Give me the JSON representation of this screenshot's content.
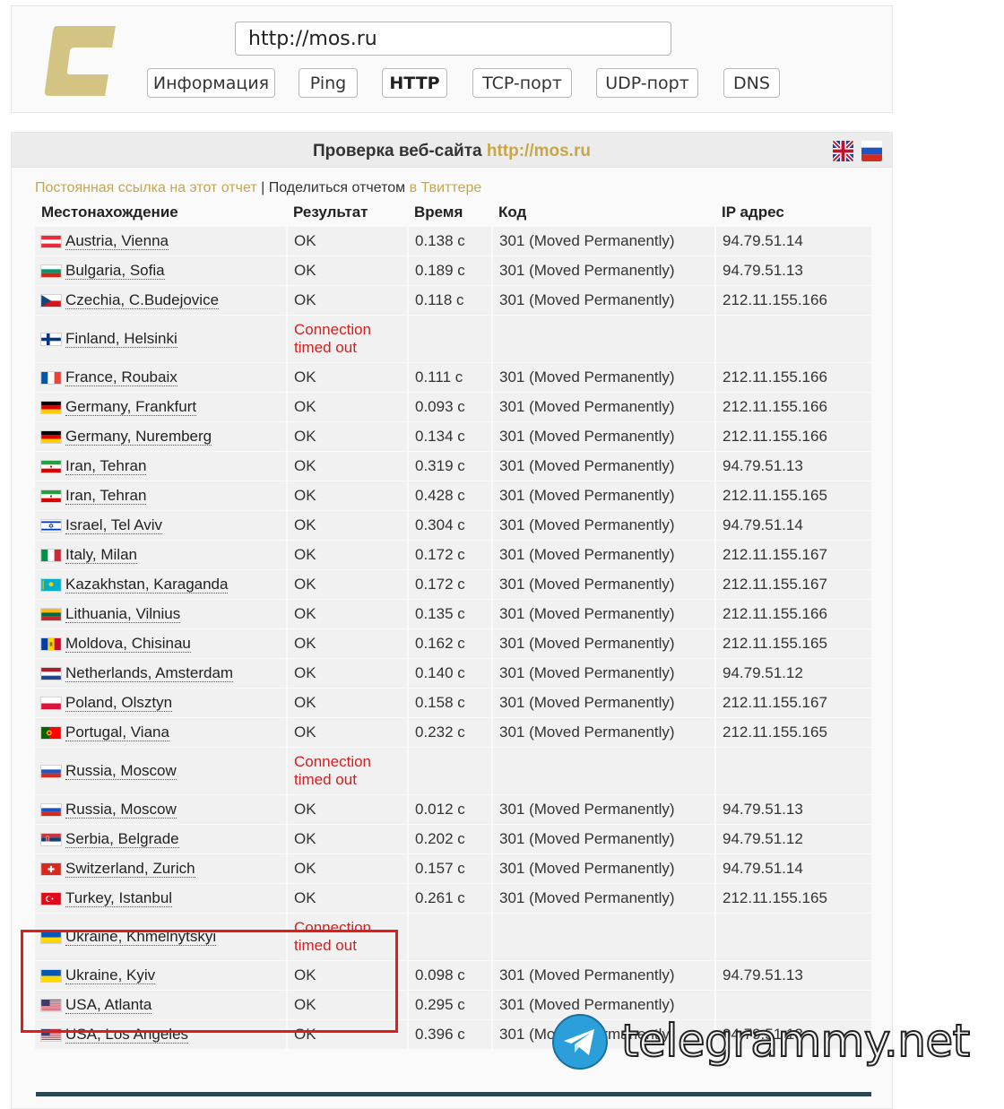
{
  "header": {
    "url_value": "http://mos.ru",
    "nav": [
      {
        "label": "Информация",
        "active": false
      },
      {
        "label": "Ping",
        "active": false
      },
      {
        "label": "HTTP",
        "active": true
      },
      {
        "label": "TCP-порт",
        "active": false
      },
      {
        "label": "UDP-порт",
        "active": false
      },
      {
        "label": "DNS",
        "active": false
      }
    ],
    "logo_color": "#d4c484"
  },
  "report": {
    "title_prefix": "Проверка веб-сайта",
    "title_link": "http://mos.ru",
    "permalink": "Постоянная ссылка на этот отчет",
    "divider": " | ",
    "share_text": "Поделиться отчетом",
    "share_link": "в Твиттере",
    "lang_flags": [
      "uk-flag-icon",
      "ru-flag-icon"
    ]
  },
  "table": {
    "headers": {
      "location": "Местонахождение",
      "result": "Результат",
      "time": "Время",
      "code": "Код",
      "ip": "IP адрес"
    },
    "rows": [
      {
        "flag": "at",
        "location": "Austria, Vienna",
        "result": "OK",
        "time": "0.138 с",
        "code": "301 (Moved Permanently)",
        "ip": "94.79.51.14"
      },
      {
        "flag": "bg",
        "location": "Bulgaria, Sofia",
        "result": "OK",
        "time": "0.189 с",
        "code": "301 (Moved Permanently)",
        "ip": "94.79.51.13"
      },
      {
        "flag": "cz",
        "location": "Czechia, C.Budejovice",
        "result": "OK",
        "time": "0.118 с",
        "code": "301 (Moved Permanently)",
        "ip": "212.11.155.166"
      },
      {
        "flag": "fi",
        "location": "Finland, Helsinki",
        "result_line1": "Connection",
        "result_line2": "timed out",
        "error": true
      },
      {
        "flag": "fr",
        "location": "France, Roubaix",
        "result": "OK",
        "time": "0.111 с",
        "code": "301 (Moved Permanently)",
        "ip": "212.11.155.166"
      },
      {
        "flag": "de",
        "location": "Germany, Frankfurt",
        "result": "OK",
        "time": "0.093 с",
        "code": "301 (Moved Permanently)",
        "ip": "212.11.155.166"
      },
      {
        "flag": "de",
        "location": "Germany, Nuremberg",
        "result": "OK",
        "time": "0.134 с",
        "code": "301 (Moved Permanently)",
        "ip": "212.11.155.166"
      },
      {
        "flag": "ir",
        "location": "Iran, Tehran",
        "result": "OK",
        "time": "0.319 с",
        "code": "301 (Moved Permanently)",
        "ip": "94.79.51.13"
      },
      {
        "flag": "ir",
        "location": "Iran, Tehran",
        "result": "OK",
        "time": "0.428 с",
        "code": "301 (Moved Permanently)",
        "ip": "212.11.155.165"
      },
      {
        "flag": "il",
        "location": "Israel, Tel Aviv",
        "result": "OK",
        "time": "0.304 с",
        "code": "301 (Moved Permanently)",
        "ip": "94.79.51.14"
      },
      {
        "flag": "it",
        "location": "Italy, Milan",
        "result": "OK",
        "time": "0.172 с",
        "code": "301 (Moved Permanently)",
        "ip": "212.11.155.167"
      },
      {
        "flag": "kz",
        "location": "Kazakhstan, Karaganda",
        "result": "OK",
        "time": "0.172 с",
        "code": "301 (Moved Permanently)",
        "ip": "212.11.155.167"
      },
      {
        "flag": "lt",
        "location": "Lithuania, Vilnius",
        "result": "OK",
        "time": "0.135 с",
        "code": "301 (Moved Permanently)",
        "ip": "212.11.155.166"
      },
      {
        "flag": "md",
        "location": "Moldova, Chisinau",
        "result": "OK",
        "time": "0.162 с",
        "code": "301 (Moved Permanently)",
        "ip": "212.11.155.165"
      },
      {
        "flag": "nl",
        "location": "Netherlands, Amsterdam",
        "result": "OK",
        "time": "0.140 с",
        "code": "301 (Moved Permanently)",
        "ip": "94.79.51.12"
      },
      {
        "flag": "pl",
        "location": "Poland, Olsztyn",
        "result": "OK",
        "time": "0.158 с",
        "code": "301 (Moved Permanently)",
        "ip": "212.11.155.167"
      },
      {
        "flag": "pt",
        "location": "Portugal, Viana",
        "result": "OK",
        "time": "0.232 с",
        "code": "301 (Moved Permanently)",
        "ip": "212.11.155.165"
      },
      {
        "flag": "ru",
        "location": "Russia, Moscow",
        "result_line1": "Connection",
        "result_line2": "timed out",
        "error": true
      },
      {
        "flag": "ru",
        "location": "Russia, Moscow",
        "result": "OK",
        "time": "0.012 с",
        "code": "301 (Moved Permanently)",
        "ip": "94.79.51.13"
      },
      {
        "flag": "rs",
        "location": "Serbia, Belgrade",
        "result": "OK",
        "time": "0.202 с",
        "code": "301 (Moved Permanently)",
        "ip": "94.79.51.12"
      },
      {
        "flag": "ch",
        "location": "Switzerland, Zurich",
        "result": "OK",
        "time": "0.157 с",
        "code": "301 (Moved Permanently)",
        "ip": "94.79.51.14"
      },
      {
        "flag": "tr",
        "location": "Turkey, Istanbul",
        "result": "OK",
        "time": "0.261 с",
        "code": "301 (Moved Permanently)",
        "ip": "212.11.155.165"
      },
      {
        "flag": "ua",
        "location": "Ukraine, Khmelnytskyi",
        "result_line1": "Connection",
        "result_line2": "timed out",
        "error": true
      },
      {
        "flag": "ua",
        "location": "Ukraine, Kyiv",
        "result": "OK",
        "time": "0.098 с",
        "code": "301 (Moved Permanently)",
        "ip": "94.79.51.13"
      },
      {
        "flag": "us",
        "location": "USA, Atlanta",
        "result": "OK",
        "time": "0.295 с",
        "code": "301 (Moved Permanently)",
        "ip": ""
      },
      {
        "flag": "us",
        "location": "USA, Los Angeles",
        "result": "OK",
        "time": "0.396 с",
        "code": "301 (Moved Permanently)",
        "ip": "94.79.51.13"
      }
    ]
  },
  "colors": {
    "gold_link": "#c7a64a",
    "error_red": "#d42020",
    "highlight_red": "#e21b1b"
  },
  "watermark": {
    "text": "telegrammy.net",
    "icon": "telegram-plane-icon"
  }
}
